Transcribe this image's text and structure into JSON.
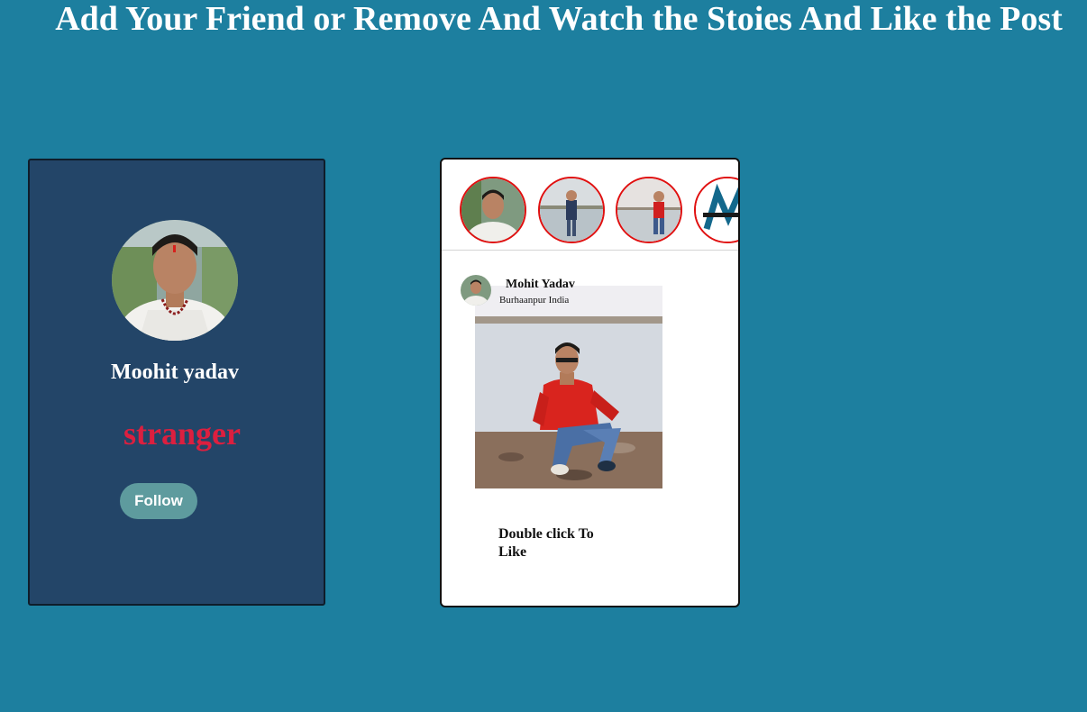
{
  "page": {
    "title": "Add Your Friend or Remove And Watch the Stoies And Like the Post"
  },
  "profile_card": {
    "name": "Moohit yadav",
    "status": "stranger",
    "follow_label": "Follow",
    "colors": {
      "card_bg": "#234568",
      "status": "#dc1f3f",
      "follow_bg": "#5e9b9e"
    }
  },
  "feed_card": {
    "stories": [
      {
        "icon": "person-portrait-photo"
      },
      {
        "icon": "person-lakeside-photo"
      },
      {
        "icon": "person-red-shirt-photo"
      },
      {
        "icon": "logo-m-photo"
      }
    ],
    "post": {
      "author": "Mohit Yadav",
      "location": "Burhaanpur India",
      "image_icon": "person-sitting-lakeside-photo",
      "like_hint": "Double click To Like"
    },
    "colors": {
      "story_ring": "#e01010"
    }
  },
  "colors": {
    "page_bg": "#1d7f9f"
  }
}
